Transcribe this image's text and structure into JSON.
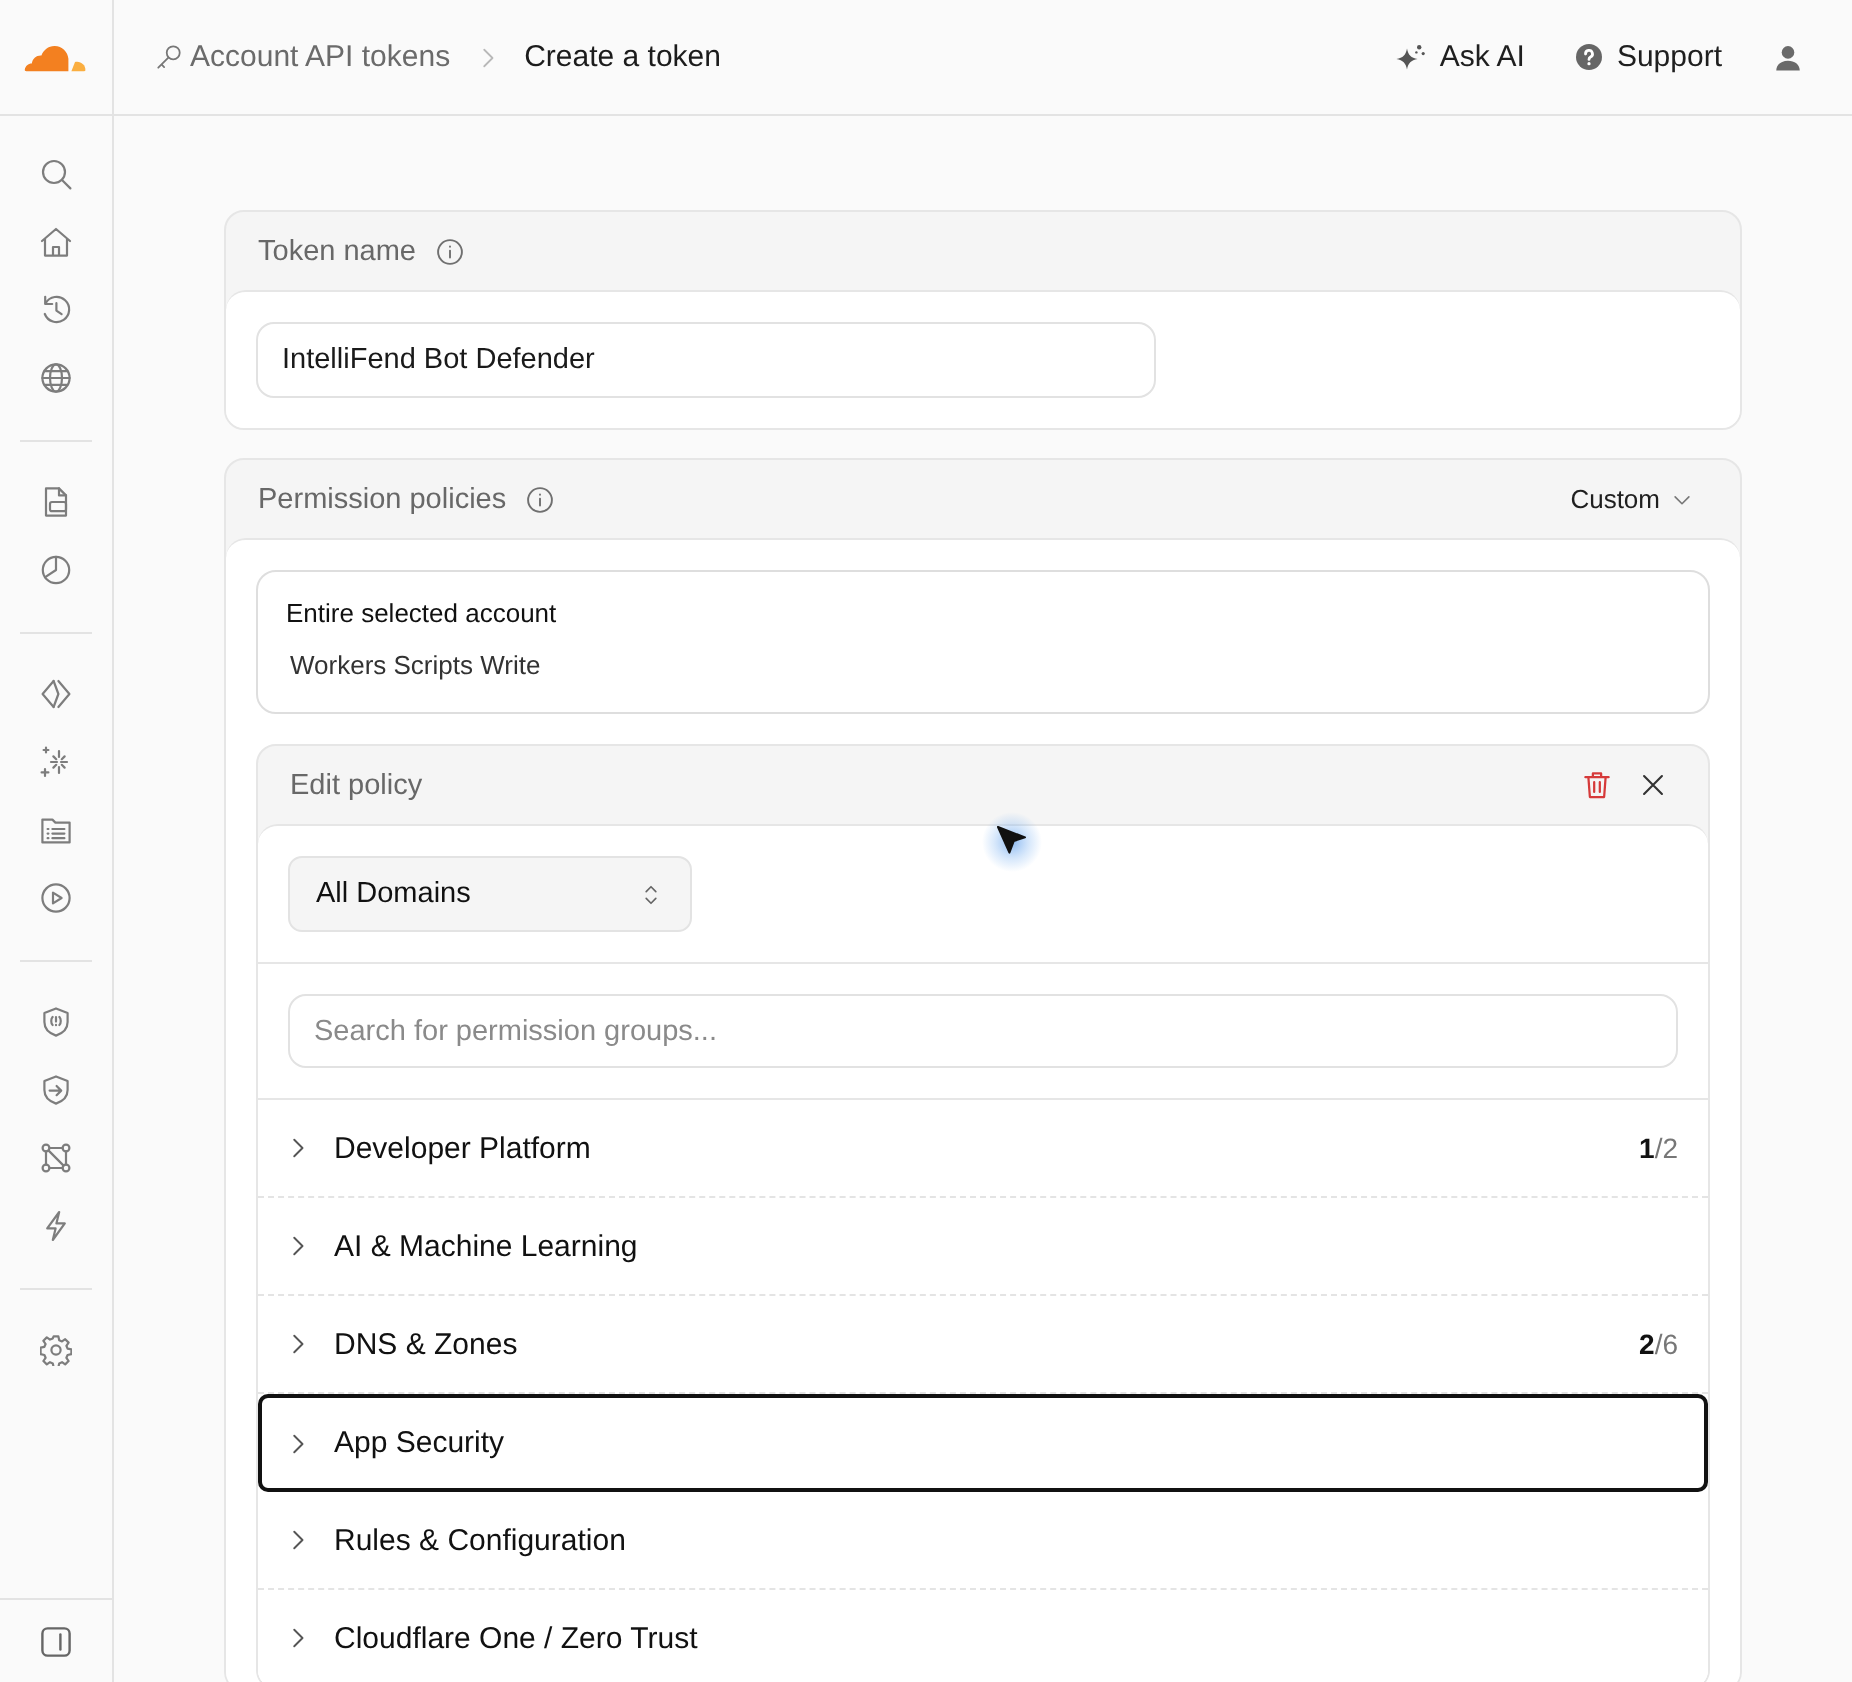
{
  "breadcrumb": [
    {
      "label": "Account API tokens",
      "current": false
    },
    {
      "label": "Create a token",
      "current": true
    }
  ],
  "header_actions": [
    {
      "kind": "ai",
      "label": "Ask AI"
    },
    {
      "kind": "support",
      "label": "Support"
    }
  ],
  "token_name": {
    "title": "Token name",
    "value": "IntelliFend Bot Defender"
  },
  "permission_policies": {
    "title": "Permission policies",
    "mode": "Custom",
    "summary": {
      "scope": "Entire selected account",
      "permissions": [
        "Workers Scripts Write"
      ]
    },
    "edit_policy": {
      "title": "Edit policy",
      "scope": "All Domains",
      "search": {
        "placeholder": "Search for permission groups..."
      },
      "groups": [
        {
          "label": "Developer Platform",
          "count": "**1**/2",
          "expanded": false,
          "focused": false
        },
        {
          "label": "AI & Machine Learning",
          "expanded": false,
          "focused": false
        },
        {
          "label": "DNS & Zones",
          "count": "**2**/6",
          "expanded": false,
          "focused": false
        },
        {
          "label": "App Security",
          "expanded": false,
          "focused": true
        },
        {
          "label": "Rules & Configuration",
          "expanded": false,
          "focused": false
        },
        {
          "label": "Cloudflare One / Zero Trust",
          "expanded": false,
          "focused": false
        }
      ]
    }
  }
}
